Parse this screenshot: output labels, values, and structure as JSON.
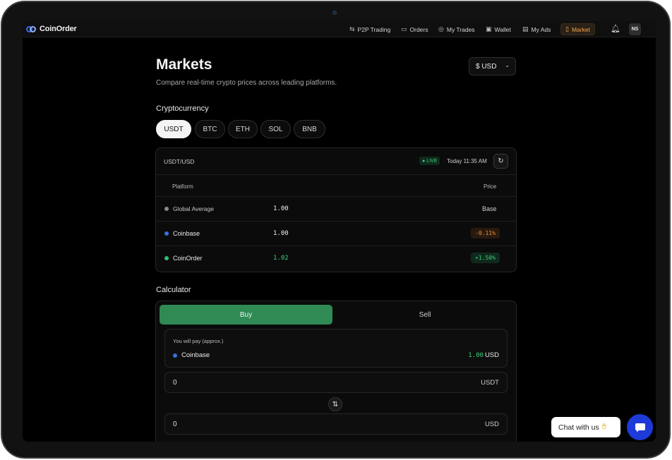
{
  "app": {
    "name": "CoinOrder"
  },
  "nav": {
    "items": [
      {
        "label": "P2P Trading",
        "icon": "swap-arrows-icon"
      },
      {
        "label": "Orders",
        "icon": "ticket-icon"
      },
      {
        "label": "My Trades",
        "icon": "handshake-icon"
      },
      {
        "label": "Wallet",
        "icon": "wallet-icon"
      },
      {
        "label": "My Ads",
        "icon": "megaphone-icon"
      },
      {
        "label": "Market",
        "icon": "document-icon",
        "active": true
      }
    ],
    "avatar_initials": "NS"
  },
  "page": {
    "title": "Markets",
    "subtitle": "Compare real-time crypto prices across leading platforms.",
    "currency_selector": "$ USD"
  },
  "crypto": {
    "label": "Cryptocurrency",
    "options": [
      "USDT",
      "BTC",
      "ETH",
      "SOL",
      "BNB"
    ],
    "selected": "USDT"
  },
  "market_table": {
    "pair": "USDT/USD",
    "live_label": "LIVE",
    "updated": "Today 11:35 AM",
    "columns": [
      "Platform",
      "Price"
    ],
    "rows": [
      {
        "platform": "Global Average",
        "price": "1.00",
        "change": "Base",
        "dot_color": "#8a8a8a"
      },
      {
        "platform": "Coinbase",
        "price": "1.00",
        "change": "-0.11%",
        "dot_color": "#3b6fe0"
      },
      {
        "platform": "CoinOrder",
        "price": "1.02",
        "change": "+1.50%",
        "dot_color": "#2fbf6e"
      }
    ]
  },
  "calculator": {
    "label": "Calculator",
    "buy_label": "Buy",
    "sell_label": "Sell",
    "pay_label": "You will pay (approx.)",
    "pay_platform": "Coinbase",
    "pay_amount": "1.00",
    "pay_currency": "USD",
    "input_value": "0",
    "input_unit": "USDT",
    "output_value": "0",
    "output_unit": "USD"
  },
  "chat": {
    "label": "Chat with us"
  },
  "colors": {
    "accent_orange": "#f2a447",
    "buy_green": "#2f8a53",
    "positive": "#3ccf7a",
    "negative": "#ef8e3a",
    "chat_blue": "#1e3ad8"
  }
}
